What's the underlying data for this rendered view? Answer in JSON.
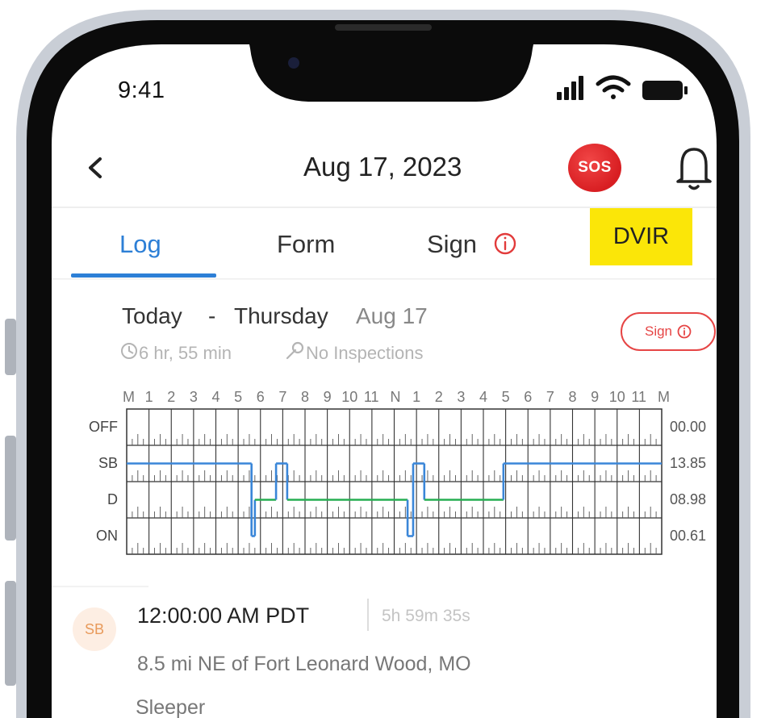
{
  "status_bar": {
    "time": "9:41"
  },
  "header": {
    "title": "Aug 17, 2023",
    "sos_label": "SOS",
    "back_icon": "chevron-left-icon",
    "bell_icon": "bell-icon"
  },
  "tabs": [
    {
      "label": "Log",
      "active": true
    },
    {
      "label": "Form",
      "active": false
    },
    {
      "label": "Sign",
      "active": false,
      "icon": "info-icon"
    },
    {
      "label": "DVIR",
      "active": false,
      "highlight": "#fbe608"
    }
  ],
  "day": {
    "today": "Today",
    "dash": "-",
    "weekday": "Thursday",
    "date": "Aug 17",
    "duration": "6 hr, 55 min",
    "inspections": "No Inspections",
    "sign_label": "Sign"
  },
  "chart_data": {
    "type": "line",
    "x_ticks": [
      "M",
      "1",
      "2",
      "3",
      "4",
      "5",
      "6",
      "7",
      "8",
      "9",
      "10",
      "11",
      "N",
      "1",
      "2",
      "3",
      "4",
      "5",
      "6",
      "7",
      "8",
      "9",
      "10",
      "11",
      "M"
    ],
    "rows": [
      "OFF",
      "SB",
      "D",
      "ON"
    ],
    "totals": [
      "00.00",
      "13.85",
      "08.98",
      "00.61"
    ],
    "xlim": [
      0,
      24
    ],
    "segments": [
      {
        "row": "SB",
        "start": 0.0,
        "end": 5.6
      },
      {
        "row": "ON",
        "start": 5.6,
        "end": 5.75
      },
      {
        "row": "D",
        "start": 5.75,
        "end": 6.7
      },
      {
        "row": "SB",
        "start": 6.7,
        "end": 7.2
      },
      {
        "row": "D",
        "start": 7.2,
        "end": 12.6
      },
      {
        "row": "ON",
        "start": 12.6,
        "end": 12.85
      },
      {
        "row": "SB",
        "start": 12.85,
        "end": 13.35
      },
      {
        "row": "D",
        "start": 13.35,
        "end": 16.9
      },
      {
        "row": "SB",
        "start": 16.9,
        "end": 24.0
      }
    ],
    "colors": {
      "SB": "#3a86d8",
      "ON": "#3a86d8",
      "D": "#27ae52",
      "OFF": "#3a86d8"
    }
  },
  "event": {
    "badge": "SB",
    "time": "12:00:00 AM PDT",
    "duration": "5h 59m 35s",
    "location": "8.5 mi NE of Fort Leonard Wood, MO",
    "status": "Sleeper"
  },
  "colors": {
    "accent": "#2d7fd6",
    "sos": "#d81e22",
    "sign_red": "#e64545",
    "dvir_highlight": "#fbe608"
  }
}
